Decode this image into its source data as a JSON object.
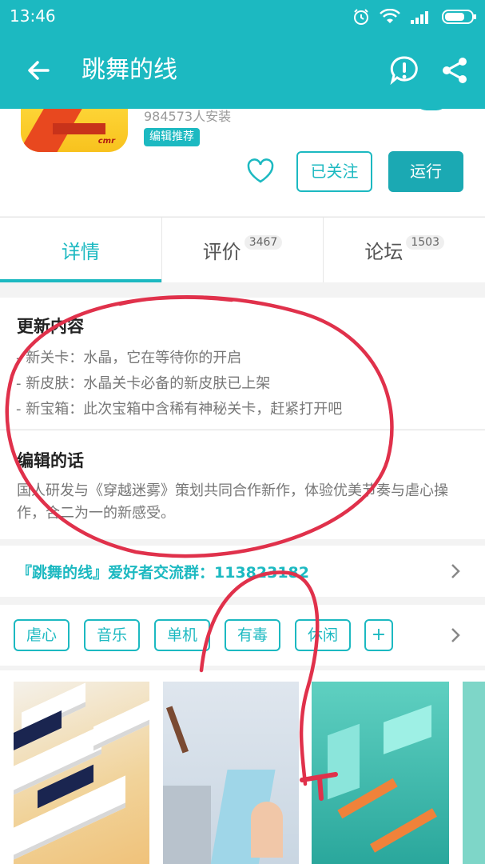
{
  "status_bar": {
    "time": "13:46"
  },
  "app_bar": {
    "title": "跳舞的线"
  },
  "app": {
    "installs": "984573人安装",
    "badge": "编辑推荐",
    "icon_logo": "cmr",
    "follow_label": "已关注",
    "run_label": "运行"
  },
  "tabs": [
    {
      "label": "详情",
      "count": ""
    },
    {
      "label": "评价",
      "count": "3467"
    },
    {
      "label": "论坛",
      "count": "1503"
    }
  ],
  "update": {
    "title": "更新内容",
    "lines": [
      "- 新关卡：水晶，它在等待你的开启",
      "- 新皮肤：水晶关卡必备的新皮肤已上架",
      "- 新宝箱：此次宝箱中含稀有神秘关卡，赶紧打开吧"
    ]
  },
  "editor": {
    "title": "编辑的话",
    "text": "国人研发与《穿越迷雾》策划共同合作新作，体验优美节奏与虐心操作，合二为一的新感受。"
  },
  "group": {
    "label": "『跳舞的线』爱好者交流群：113823182"
  },
  "tags": [
    "虐心",
    "音乐",
    "单机",
    "有毒",
    "休闲",
    "+"
  ],
  "colors": {
    "accent": "#1cb9c1",
    "run_button": "#1ba9b3",
    "annotation": "#e0314b"
  }
}
